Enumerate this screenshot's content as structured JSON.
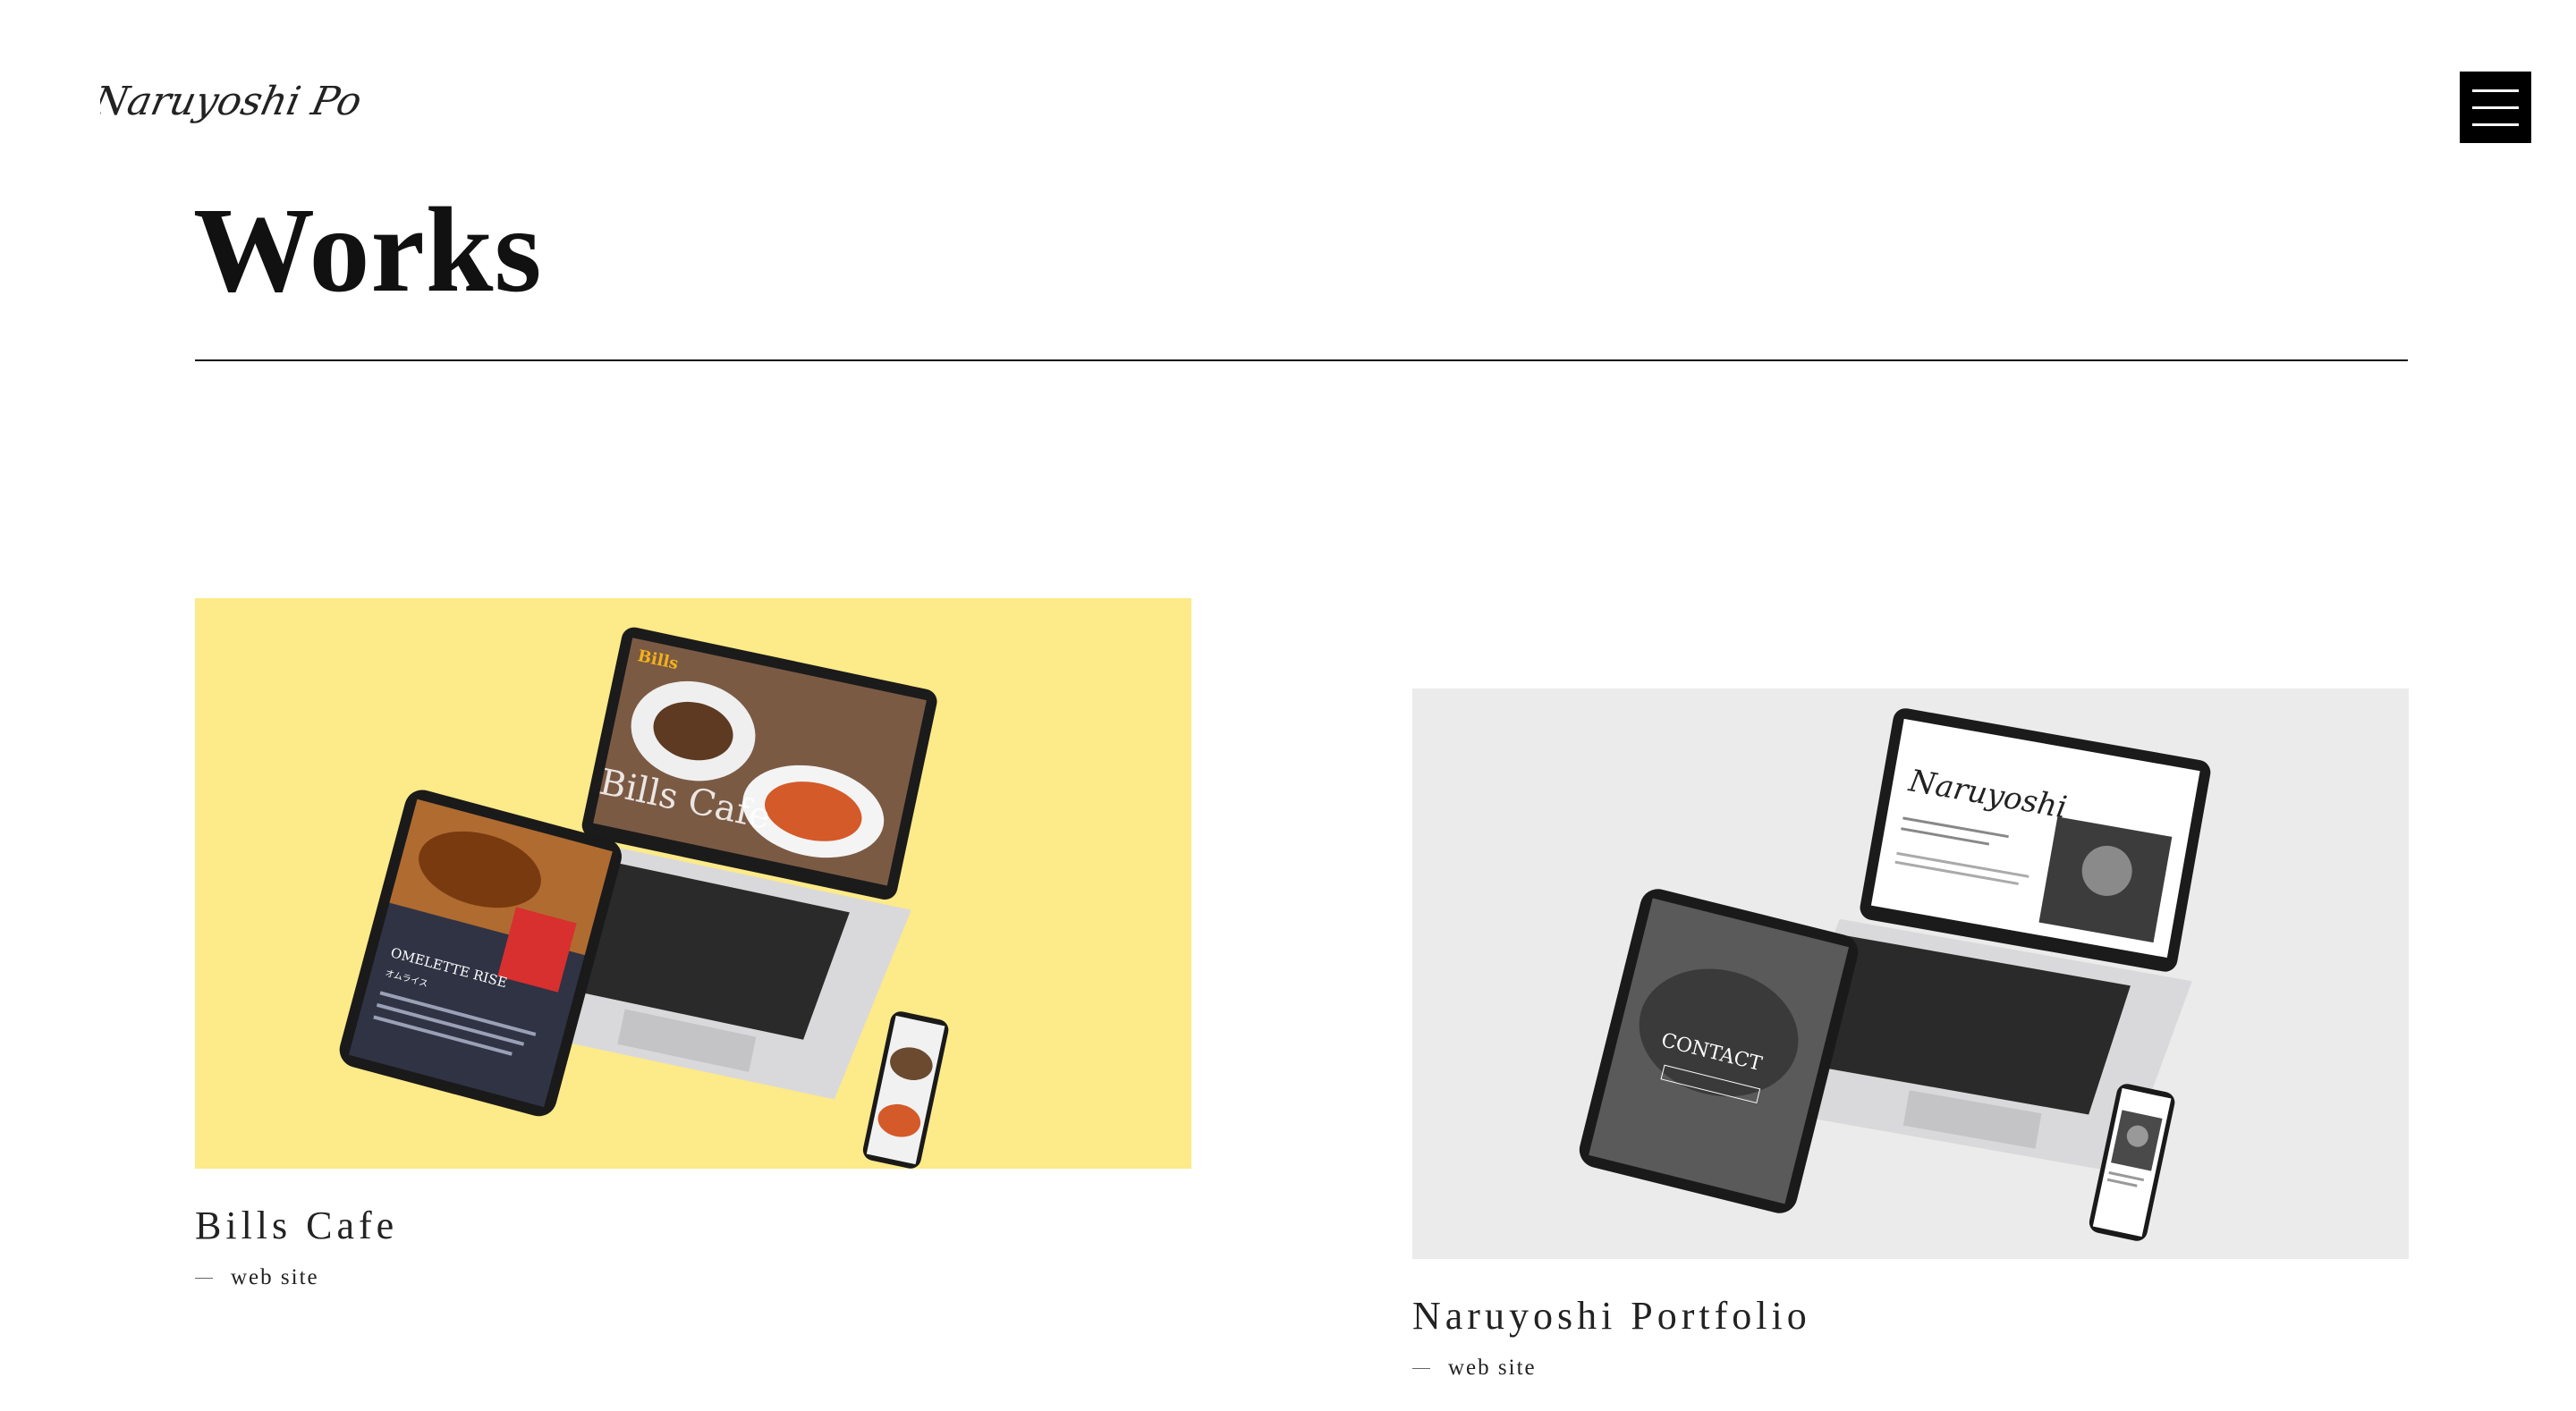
{
  "header": {
    "logo_text": "Naruyoshi Portfolio",
    "menu_icon": "hamburger-icon"
  },
  "main": {
    "title": "Works"
  },
  "works": [
    {
      "title": "Bills Cafe",
      "type": "web site",
      "thumb_bg": "#fdea88",
      "screen_texts": {
        "laptop_logo": "Bills",
        "laptop_heading": "Bills Cafe",
        "tablet_heading": "OMELETTE RISE",
        "tablet_sub": "オムライス"
      }
    },
    {
      "title": "Naruyoshi Portfolio",
      "type": "web site",
      "thumb_bg": "#ebebeb",
      "screen_texts": {
        "laptop_heading": "Naruyoshi",
        "tablet_heading": "CONTACT"
      }
    }
  ],
  "colors": {
    "background": "#ffffff",
    "text": "#111111",
    "accent_yellow": "#fdea88",
    "menu_button": "#000000"
  }
}
